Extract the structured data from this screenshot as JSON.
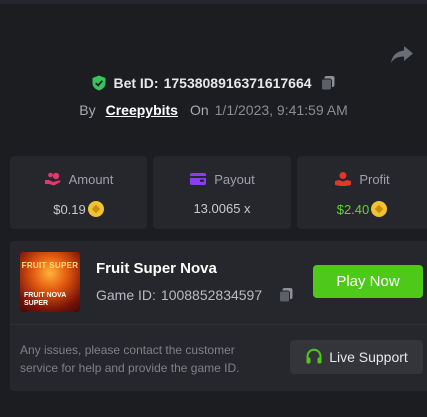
{
  "bet": {
    "label": "Bet ID:",
    "id": "1753808916371617664",
    "by_label": "By",
    "user": "Creepybits",
    "on_label": "On",
    "date": "1/1/2023, 9:41:59 AM"
  },
  "stats": {
    "amount": {
      "label": "Amount",
      "value": "$0.19"
    },
    "payout": {
      "label": "Payout",
      "value": "13.0065 x"
    },
    "profit": {
      "label": "Profit",
      "value": "$2.40"
    }
  },
  "game": {
    "title": "Fruit Super Nova",
    "id_label": "Game ID:",
    "id": "1008852834597",
    "thumb_top": "FRUIT SUPER",
    "thumb_line1": "FRUIT NOVA",
    "thumb_line2": "SUPER",
    "play_label": "Play Now"
  },
  "support": {
    "help_text": "Any issues, please contact the customer service for help and provide the game ID.",
    "button_label": "Live Support"
  },
  "colors": {
    "accent_green": "#4fc919",
    "profit_green": "#5ed43a",
    "amount_icon": "#e8356a",
    "payout_icon": "#8b3df0",
    "profit_icon": "#e0362c",
    "shield": "#37c45a"
  },
  "icons": {
    "share": "share-icon",
    "shield": "shield-check-icon",
    "copy": "copy-icon",
    "amount": "hand-coins-icon",
    "payout": "wallet-icon",
    "profit": "hand-money-icon",
    "coin": "coin-icon",
    "headset": "headset-icon"
  }
}
